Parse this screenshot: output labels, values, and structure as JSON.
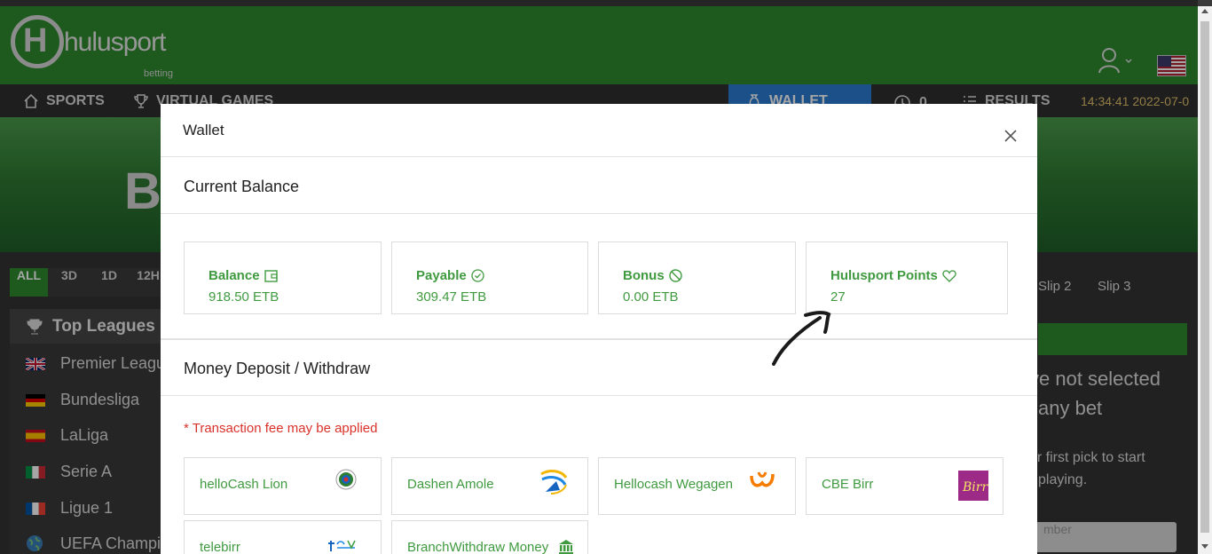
{
  "header": {
    "logo_text": "hulusport",
    "logo_sub": "betting"
  },
  "nav": {
    "sports": "SPORTS",
    "virtual_games": "VIRTUAL GAMES",
    "wallet": "WALLET",
    "history_count": "0",
    "results": "RESULTS",
    "time": "14:34:41 2022-07-0"
  },
  "banner": {
    "text": "B"
  },
  "filters": [
    "ALL",
    "3D",
    "1D",
    "12H"
  ],
  "top_leagues": {
    "title": "Top Leagues",
    "items": [
      {
        "name": "Premier League"
      },
      {
        "name": "Bundesliga"
      },
      {
        "name": "LaLiga"
      },
      {
        "name": "Serie A"
      },
      {
        "name": "Ligue 1"
      },
      {
        "name": "UEFA Champions"
      }
    ]
  },
  "betslip": {
    "tabs": [
      "Slip 2",
      "Slip 3"
    ],
    "message_line1": "ve not selected",
    "message_line2": "any bet",
    "sub_line1": "ur first pick to start",
    "sub_line2": "playing.",
    "phone_placeholder": "mber"
  },
  "modal": {
    "title": "Wallet",
    "current_balance_title": "Current Balance",
    "balances": [
      {
        "label": "Balance",
        "value": "918.50 ETB",
        "icon": "wallet-icon"
      },
      {
        "label": "Payable",
        "value": "309.47 ETB",
        "icon": "check-circle-icon"
      },
      {
        "label": "Bonus",
        "value": "0.00 ETB",
        "icon": "ban-icon"
      },
      {
        "label": "Hulusport Points",
        "value": "27",
        "icon": "heart-icon"
      }
    ],
    "deposit_title": "Money Deposit / Withdraw",
    "fee_note": "* Transaction fee may be applied",
    "methods": [
      {
        "name": "helloCash Lion"
      },
      {
        "name": "Dashen Amole"
      },
      {
        "name": "Hellocash Wegagen"
      },
      {
        "name": "CBE Birr",
        "logo_text": "Birr"
      },
      {
        "name": "telebirr"
      },
      {
        "name": "BranchWithdraw Money"
      }
    ]
  },
  "colors": {
    "brand_green": "#2e8b2e",
    "text_green": "#3f9a3f",
    "fee_red": "#d9322b",
    "wallet_blue": "#2b7bd1",
    "time_gold": "#e2c06b"
  }
}
